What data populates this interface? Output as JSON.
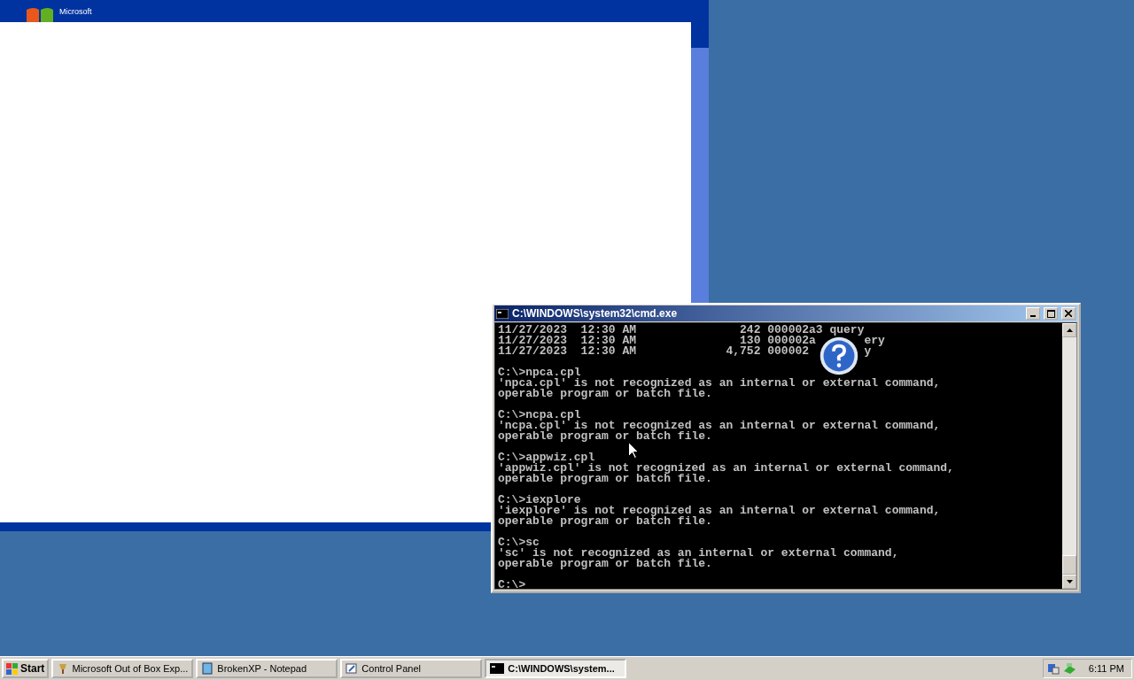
{
  "oobe_window": {
    "logo_text": "Microsoft"
  },
  "console_window": {
    "title": "C:\\WINDOWS\\system32\\cmd.exe",
    "blocks": [
      [
        "11/27/2023  12:30 AM               242 000002a3 query",
        [
          "11/27/2023  12:30 AM               130 000002a",
          "ery"
        ],
        [
          "11/27/2023  12:30 AM             4,752 000002",
          "y"
        ]
      ],
      [
        "C:\\>npca.cpl",
        "'npca.cpl' is not recognized as an internal or external command,",
        "operable program or batch file."
      ],
      [
        "C:\\>ncpa.cpl",
        "'ncpa.cpl' is not recognized as an internal or external command,",
        "operable program or batch file."
      ],
      [
        "C:\\>appwiz.cpl",
        "'appwiz.cpl' is not recognized as an internal or external command,",
        "operable program or batch file."
      ],
      [
        "C:\\>iexplore",
        "'iexplore' is not recognized as an internal or external command,",
        "operable program or batch file."
      ],
      [
        "C:\\>sc",
        "'sc' is not recognized as an internal or external command,",
        "operable program or batch file."
      ],
      [
        "C:\\>"
      ]
    ]
  },
  "taskbar": {
    "start_label": "Start",
    "tasks": [
      {
        "label": "Microsoft Out of Box Exp...",
        "selected": false
      },
      {
        "label": "BrokenXP - Notepad",
        "selected": false
      },
      {
        "label": "Control Panel",
        "selected": false
      },
      {
        "label": "C:\\WINDOWS\\system...",
        "selected": true
      }
    ],
    "clock": "6:11 PM"
  }
}
